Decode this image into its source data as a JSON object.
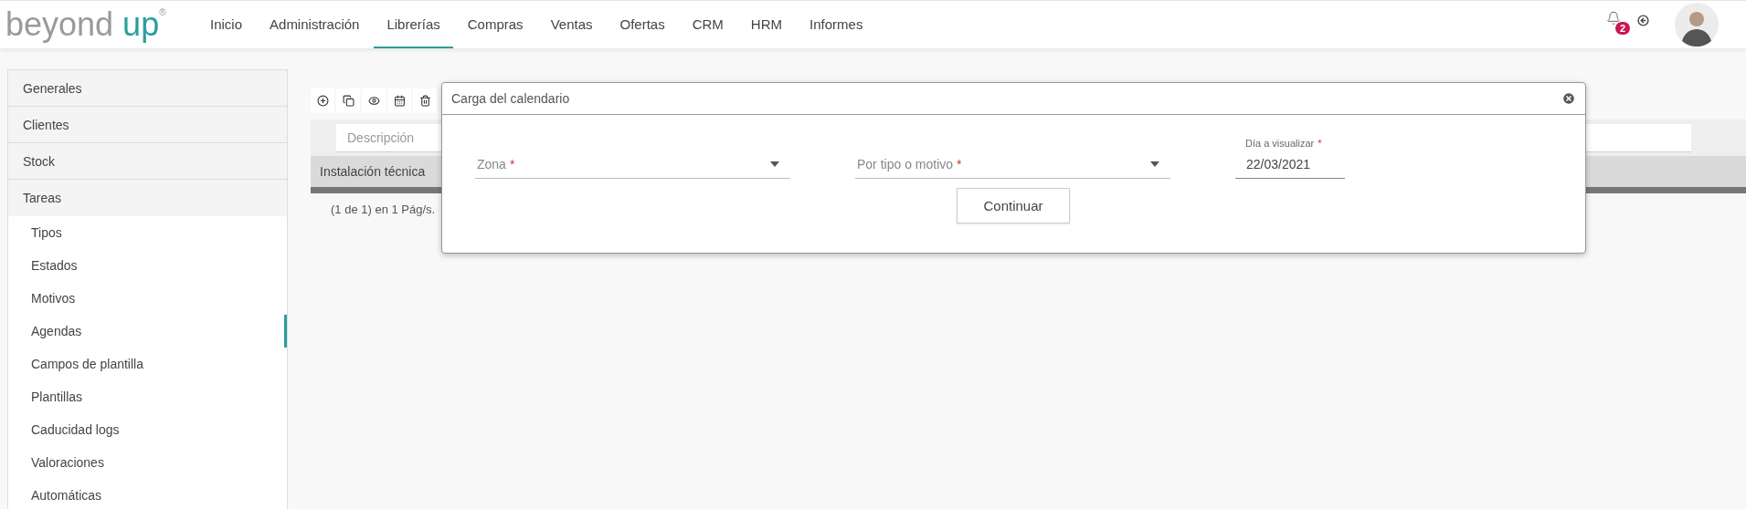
{
  "header": {
    "logo": {
      "word": "beyond",
      "accent": "up",
      "mark": "®"
    },
    "nav": [
      {
        "label": "Inicio",
        "selected": false
      },
      {
        "label": "Administración",
        "selected": false
      },
      {
        "label": "Librerías",
        "selected": true
      },
      {
        "label": "Compras",
        "selected": false
      },
      {
        "label": "Ventas",
        "selected": false
      },
      {
        "label": "Ofertas",
        "selected": false
      },
      {
        "label": "CRM",
        "selected": false
      },
      {
        "label": "HRM",
        "selected": false
      },
      {
        "label": "Informes",
        "selected": false
      }
    ],
    "notifications": {
      "count": "2"
    }
  },
  "sidebar": {
    "sections": [
      {
        "label": "Generales",
        "expanded": false
      },
      {
        "label": "Clientes",
        "expanded": false
      },
      {
        "label": "Stock",
        "expanded": false
      },
      {
        "label": "Tareas",
        "expanded": true,
        "children": [
          {
            "label": "Tipos",
            "selected": false
          },
          {
            "label": "Estados",
            "selected": false
          },
          {
            "label": "Motivos",
            "selected": false
          },
          {
            "label": "Agendas",
            "selected": true
          },
          {
            "label": "Campos de plantilla",
            "selected": false
          },
          {
            "label": "Plantillas",
            "selected": false
          },
          {
            "label": "Caducidad logs",
            "selected": false
          },
          {
            "label": "Valoraciones",
            "selected": false
          },
          {
            "label": "Automáticas",
            "selected": false
          }
        ]
      }
    ]
  },
  "table": {
    "filter_placeholder": "Descripción",
    "rows": [
      {
        "cells": [
          "Instalación técnica"
        ]
      }
    ],
    "pager": "(1 de 1) en 1 Pág/s."
  },
  "dialog": {
    "title": "Carga del calendario",
    "fields": [
      {
        "kind": "select",
        "label": "Zona",
        "mark": "*"
      },
      {
        "kind": "select",
        "label": "Por tipo o motivo",
        "mark": "*"
      },
      {
        "kind": "date",
        "label": "Día a visualizar",
        "mark": "*",
        "value": "22/03/2021"
      }
    ],
    "buttons": [
      "Continuar"
    ]
  }
}
